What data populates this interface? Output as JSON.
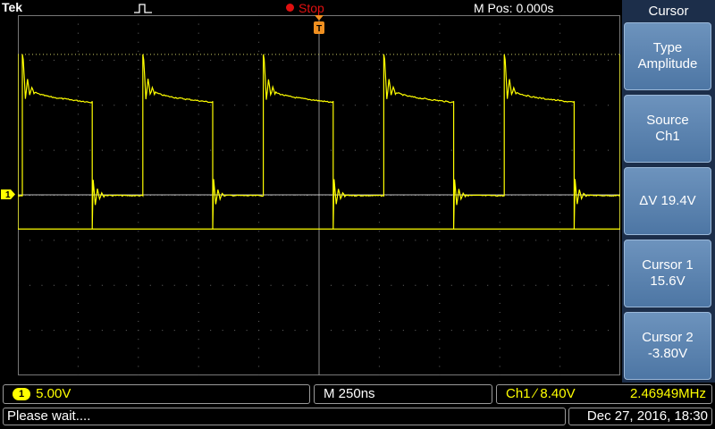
{
  "header": {
    "brand": "Tek",
    "run_state": "Stop",
    "horizontal_position": "M Pos: 0.000s"
  },
  "colors": {
    "trace": "#ffff00",
    "cursor_line": "#ffffff",
    "stop": "#e01010",
    "trigger_marker": "#f09020",
    "menu_bg": "#1c2e4a"
  },
  "channel_marker": "1",
  "trigger_marker_label": "T",
  "side_menu": {
    "title": "Cursor",
    "buttons": [
      {
        "line1": "Type",
        "line2": "Amplitude"
      },
      {
        "line1": "Source",
        "line2": "Ch1"
      },
      {
        "line1": "ΔV 19.4V",
        "line2": ""
      },
      {
        "line1": "Cursor 1",
        "line2": "15.6V"
      },
      {
        "line1": "Cursor 2",
        "line2": "-3.80V"
      }
    ]
  },
  "status": {
    "ch1_label": "1",
    "ch1_scale": "5.00V",
    "timebase": "M 250ns",
    "trigger_source": "Ch1",
    "trigger_slope": "∕",
    "trigger_level": "8.40V",
    "frequency": "2.46949MHz"
  },
  "message": "Please wait....",
  "datetime": "Dec 27, 2016, 18:30",
  "waveform": {
    "type": "square",
    "period_ns": 500,
    "duty": 0.58,
    "cursor1_v": 15.6,
    "cursor2_v": -3.8
  }
}
